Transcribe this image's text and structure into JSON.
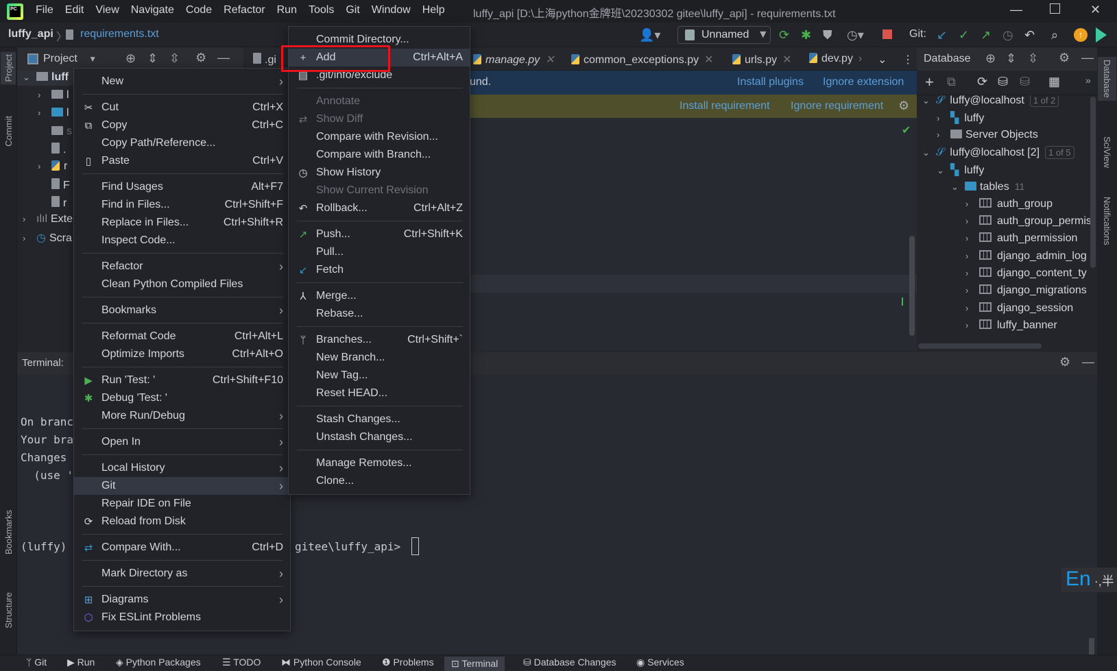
{
  "titlebar": {
    "menu": [
      "File",
      "Edit",
      "View",
      "Navigate",
      "Code",
      "Refactor",
      "Run",
      "Tools",
      "Git",
      "Window",
      "Help"
    ],
    "title": "luffy_api [D:\\上海python金牌班\\20230302 gitee\\luffy_api] - requirements.txt"
  },
  "navbar": {
    "project": "luffy_api",
    "file": "requirements.txt",
    "run_config": "Unnamed",
    "git_label": "Git:"
  },
  "stripes": {
    "left": [
      "Project",
      "Commit",
      "Bookmarks",
      "Structure"
    ],
    "right": [
      "Database",
      "SciView",
      "Notifications"
    ]
  },
  "project": {
    "title": "Project",
    "tree": [
      "luff",
      "l",
      "l",
      "s",
      ".",
      "r",
      "F",
      "r",
      "Exte",
      "Scra"
    ]
  },
  "tabs": [
    {
      "label": ".gi"
    },
    {
      "label": "manage.py"
    },
    {
      "label": "common_exceptions.py"
    },
    {
      "label": "urls.py"
    },
    {
      "label": "dev.py"
    }
  ],
  "notifications": {
    "text_fragment": "und.",
    "install_plugins": "Install plugins",
    "ignore_extension": "Ignore extension",
    "install_requirement": "Install requirement",
    "ignore_requirement": "Ignore requirement"
  },
  "database": {
    "title": "Database",
    "tree": [
      {
        "label": "luffy@localhost",
        "badge": "1 of 2",
        "chev": "v",
        "indent": 0,
        "icon": "mysql"
      },
      {
        "label": "luffy",
        "chev": ">",
        "indent": 1,
        "icon": "schema"
      },
      {
        "label": "Server Objects",
        "chev": ">",
        "indent": 1,
        "icon": "server"
      },
      {
        "label": "luffy@localhost [2]",
        "badge": "1 of 5",
        "chev": "v",
        "indent": 0,
        "icon": "mysql"
      },
      {
        "label": "luffy",
        "chev": "v",
        "indent": 1,
        "icon": "schema"
      },
      {
        "label": "tables",
        "count": "11",
        "chev": "v",
        "indent": 2,
        "icon": "folder"
      },
      {
        "label": "auth_group",
        "chev": ">",
        "indent": 3,
        "icon": "table"
      },
      {
        "label": "auth_group_permis",
        "chev": ">",
        "indent": 3,
        "icon": "table"
      },
      {
        "label": "auth_permission",
        "chev": ">",
        "indent": 3,
        "icon": "table"
      },
      {
        "label": "django_admin_log",
        "chev": ">",
        "indent": 3,
        "icon": "table"
      },
      {
        "label": "django_content_ty",
        "chev": ">",
        "indent": 3,
        "icon": "table"
      },
      {
        "label": "django_migrations",
        "chev": ">",
        "indent": 3,
        "icon": "table"
      },
      {
        "label": "django_session",
        "chev": ">",
        "indent": 3,
        "icon": "table"
      },
      {
        "label": "luffy_banner",
        "chev": ">",
        "indent": 3,
        "icon": "table"
      }
    ]
  },
  "terminal": {
    "title": "Terminal:",
    "lines": [
      "On branc",
      "Your bra",
      "",
      "Changes",
      "  (use '"
    ],
    "prompt_left": "(luffy)",
    "prompt_right": "gitee\\luffy_api>"
  },
  "bottombar": [
    "Git",
    "Run",
    "Python Packages",
    "TODO",
    "Python Console",
    "Problems",
    "Terminal",
    "Database Changes",
    "Services"
  ],
  "bottombar_active": "Terminal",
  "ime": "En",
  "context_menu": [
    {
      "label": "New",
      "submenu": true
    },
    {
      "sep": true
    },
    {
      "label": "Cut",
      "shortcut": "Ctrl+X",
      "icon": "✂"
    },
    {
      "label": "Copy",
      "shortcut": "Ctrl+C",
      "icon": "⧉"
    },
    {
      "label": "Copy Path/Reference..."
    },
    {
      "label": "Paste",
      "shortcut": "Ctrl+V",
      "icon": "▯"
    },
    {
      "sep": true
    },
    {
      "label": "Find Usages",
      "shortcut": "Alt+F7"
    },
    {
      "label": "Find in Files...",
      "shortcut": "Ctrl+Shift+F"
    },
    {
      "label": "Replace in Files...",
      "shortcut": "Ctrl+Shift+R"
    },
    {
      "label": "Inspect Code..."
    },
    {
      "sep": true
    },
    {
      "label": "Refactor",
      "submenu": true
    },
    {
      "label": "Clean Python Compiled Files"
    },
    {
      "sep": true
    },
    {
      "label": "Bookmarks",
      "submenu": true
    },
    {
      "sep": true
    },
    {
      "label": "Reformat Code",
      "shortcut": "Ctrl+Alt+L"
    },
    {
      "label": "Optimize Imports",
      "shortcut": "Ctrl+Alt+O"
    },
    {
      "sep": true
    },
    {
      "label": "Run 'Test: '",
      "shortcut": "Ctrl+Shift+F10",
      "icon": "▶",
      "icon_color": "#4caf50"
    },
    {
      "label": "Debug 'Test: '",
      "icon": "✱",
      "icon_color": "#4caf50"
    },
    {
      "label": "More Run/Debug",
      "submenu": true
    },
    {
      "sep": true
    },
    {
      "label": "Open In",
      "submenu": true
    },
    {
      "sep": true
    },
    {
      "label": "Local History",
      "submenu": true
    },
    {
      "label": "Git",
      "submenu": true,
      "selected": true
    },
    {
      "label": "Repair IDE on File"
    },
    {
      "label": "Reload from Disk",
      "icon": "⟳"
    },
    {
      "sep": true
    },
    {
      "label": "Compare With...",
      "shortcut": "Ctrl+D",
      "icon": "⇄",
      "icon_color": "#3592c4"
    },
    {
      "sep": true
    },
    {
      "label": "Mark Directory as",
      "submenu": true
    },
    {
      "sep": true
    },
    {
      "label": "Diagrams",
      "submenu": true,
      "icon": "⊞",
      "icon_color": "#5e9ed6"
    },
    {
      "label": "Fix ESLint Problems",
      "icon": "⬡",
      "icon_color": "#7b68ee"
    }
  ],
  "git_menu": [
    {
      "label": "Commit Directory..."
    },
    {
      "label": "Add",
      "shortcut": "Ctrl+Alt+A",
      "icon": "+",
      "selected": true
    },
    {
      "label": ".git/info/exclude",
      "icon": "▤"
    },
    {
      "sep": true
    },
    {
      "label": "Annotate",
      "disabled": true
    },
    {
      "label": "Show Diff",
      "disabled": true,
      "icon": "⇄"
    },
    {
      "label": "Compare with Revision..."
    },
    {
      "label": "Compare with Branch..."
    },
    {
      "label": "Show History",
      "icon": "◷"
    },
    {
      "label": "Show Current Revision",
      "disabled": true
    },
    {
      "label": "Rollback...",
      "shortcut": "Ctrl+Alt+Z",
      "icon": "↶"
    },
    {
      "sep": true
    },
    {
      "label": "Push...",
      "shortcut": "Ctrl+Shift+K",
      "icon": "↗",
      "icon_color": "#4caf50"
    },
    {
      "label": "Pull..."
    },
    {
      "label": "Fetch",
      "icon": "↙",
      "icon_color": "#3592c4"
    },
    {
      "sep": true
    },
    {
      "label": "Merge...",
      "icon": "⅄"
    },
    {
      "label": "Rebase..."
    },
    {
      "sep": true
    },
    {
      "label": "Branches...",
      "shortcut": "Ctrl+Shift+`",
      "icon": "ᛘ"
    },
    {
      "label": "New Branch..."
    },
    {
      "label": "New Tag..."
    },
    {
      "label": "Reset HEAD..."
    },
    {
      "sep": true
    },
    {
      "label": "Stash Changes..."
    },
    {
      "label": "Unstash Changes..."
    },
    {
      "sep": true
    },
    {
      "label": "Manage Remotes..."
    },
    {
      "label": "Clone..."
    }
  ],
  "colors": {
    "highlight_box": "#e8141b",
    "link": "#5e9ed6",
    "menu_selected": "#343843"
  }
}
